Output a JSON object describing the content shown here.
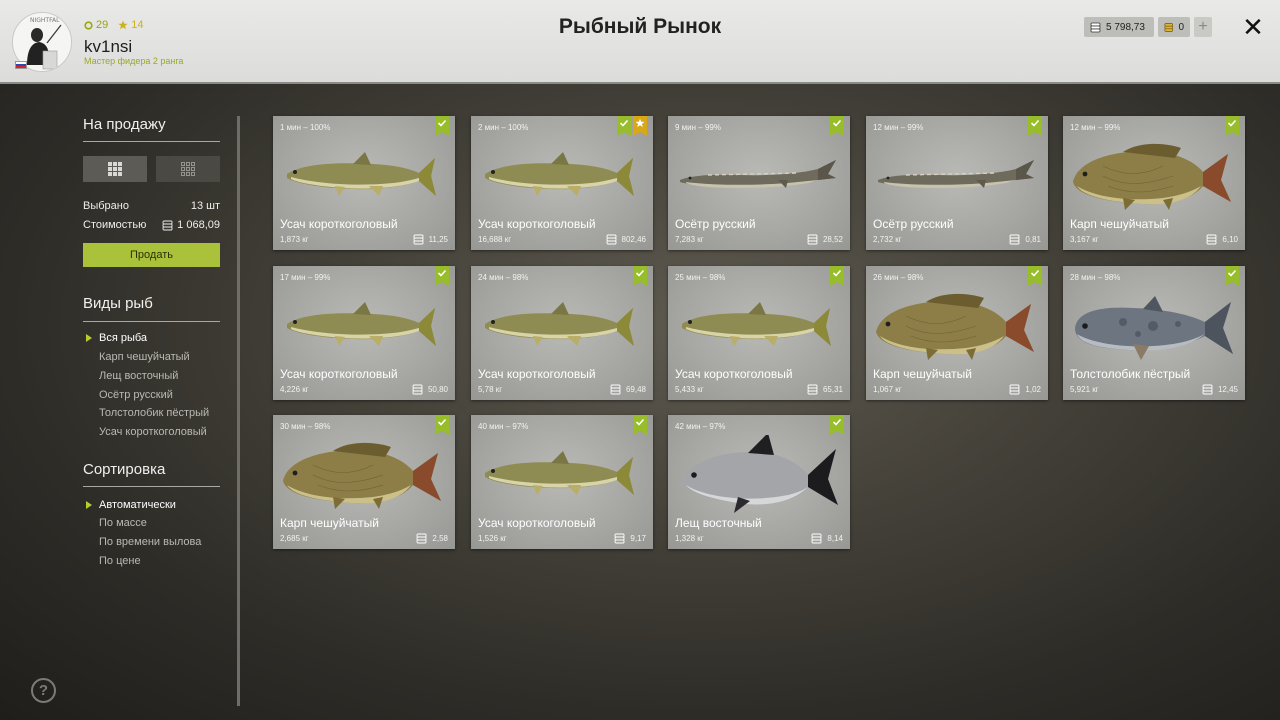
{
  "header": {
    "title": "Рыбный Рынок",
    "stats": {
      "level": "29",
      "stars": "14"
    },
    "username": "kv1nsi",
    "rank": "Мастер фидера 2 ранга",
    "silver": "5 798,73",
    "gold": "0",
    "plus_label": "+",
    "close_label": "✕",
    "avatar_text": "NIGHTFAL"
  },
  "sidebar": {
    "sale_heading": "На продажу",
    "selected_label": "Выбрано",
    "selected_value": "13 шт",
    "cost_label": "Стоимостью",
    "cost_value": "1 068,09",
    "sell_button": "Продать",
    "species_heading": "Виды рыб",
    "species": [
      "Вся рыба",
      "Карп чешуйчатый",
      "Лещ восточный",
      "Осётр русский",
      "Толстолобик пёстрый",
      "Усач короткоголовый"
    ],
    "sort_heading": "Сортировка",
    "sort": [
      "Автоматически",
      "По массе",
      "По времени вылова",
      "По цене"
    ],
    "help_label": "?"
  },
  "cards": [
    {
      "time": "1 мин – 100%",
      "name": "Усач короткоголовый",
      "weight": "1,873 кг",
      "price": "11,25",
      "fish": "barbel",
      "fav": false
    },
    {
      "time": "2 мин – 100%",
      "name": "Усач короткоголовый",
      "weight": "16,688 кг",
      "price": "802,46",
      "fish": "barbel",
      "fav": true
    },
    {
      "time": "9 мин – 99%",
      "name": "Осётр русский",
      "weight": "7,283 кг",
      "price": "28,52",
      "fish": "sturgeon",
      "fav": false
    },
    {
      "time": "12 мин – 99%",
      "name": "Осётр русский",
      "weight": "2,732 кг",
      "price": "0,81",
      "fish": "sturgeon",
      "fav": false
    },
    {
      "time": "12 мин – 99%",
      "name": "Карп чешуйчатый",
      "weight": "3,167 кг",
      "price": "6,10",
      "fish": "carp",
      "fav": false
    },
    {
      "time": "17 мин – 99%",
      "name": "Усач короткоголовый",
      "weight": "4,226 кг",
      "price": "50,80",
      "fish": "barbel",
      "fav": false
    },
    {
      "time": "24 мин – 98%",
      "name": "Усач короткоголовый",
      "weight": "5,78 кг",
      "price": "69,48",
      "fish": "barbel",
      "fav": false
    },
    {
      "time": "25 мин – 98%",
      "name": "Усач короткоголовый",
      "weight": "5,433 кг",
      "price": "65,31",
      "fish": "barbel",
      "fav": false
    },
    {
      "time": "26 мин – 98%",
      "name": "Карп чешуйчатый",
      "weight": "1,067 кг",
      "price": "1,02",
      "fish": "carp",
      "fav": false
    },
    {
      "time": "28 мин – 98%",
      "name": "Толстолобик пёстрый",
      "weight": "5,921 кг",
      "price": "12,45",
      "fish": "bighead",
      "fav": false
    },
    {
      "time": "30 мин – 98%",
      "name": "Карп чешуйчатый",
      "weight": "2,685 кг",
      "price": "2,58",
      "fish": "carp",
      "fav": false
    },
    {
      "time": "40 мин – 97%",
      "name": "Усач короткоголовый",
      "weight": "1,526 кг",
      "price": "9,17",
      "fish": "barbel",
      "fav": false
    },
    {
      "time": "42 мин – 97%",
      "name": "Лещ восточный",
      "weight": "1,328 кг",
      "price": "8,14",
      "fish": "bream",
      "fav": false
    }
  ],
  "colors": {
    "accent": "#a9c23a",
    "check": "#97bd2a",
    "favorite": "#d9a818"
  },
  "icons": {
    "level": "ring-icon",
    "stars": "star-icon",
    "silver": "coins-icon",
    "gold": "gold-coins-icon",
    "check": "check-icon",
    "fav": "star-icon",
    "price": "coins-icon"
  }
}
